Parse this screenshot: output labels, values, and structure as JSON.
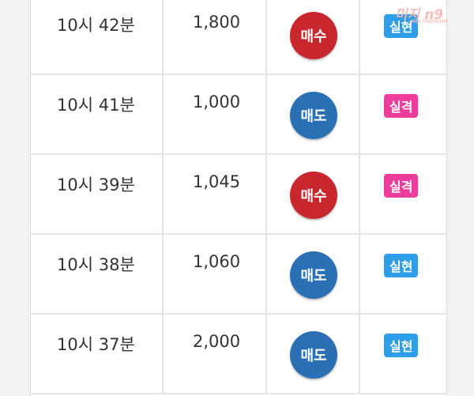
{
  "rows": [
    {
      "time": "10시 42분",
      "price": "1,800",
      "trade": "매수",
      "trade_kind": "buy",
      "result": "실현",
      "result_kind": "real"
    },
    {
      "time": "10시 41분",
      "price": "1,000",
      "trade": "매도",
      "trade_kind": "sell",
      "result": "실격",
      "result_kind": "hit"
    },
    {
      "time": "10시 39분",
      "price": "1,045",
      "trade": "매수",
      "trade_kind": "buy",
      "result": "실격",
      "result_kind": "hit"
    },
    {
      "time": "10시 38분",
      "price": "1,060",
      "trade": "매도",
      "trade_kind": "sell",
      "result": "실현",
      "result_kind": "real"
    },
    {
      "time": "10시 37분",
      "price": "2,000",
      "trade": "매도",
      "trade_kind": "sell",
      "result": "실현",
      "result_kind": "real"
    }
  ],
  "colors": {
    "buy": "#c8282d",
    "sell": "#2b6fb5",
    "real": "#2e9ee8",
    "hit": "#ee3c9c"
  },
  "watermark": {
    "text": "미지 n9",
    "sub": "MIJI PREMIUM"
  }
}
